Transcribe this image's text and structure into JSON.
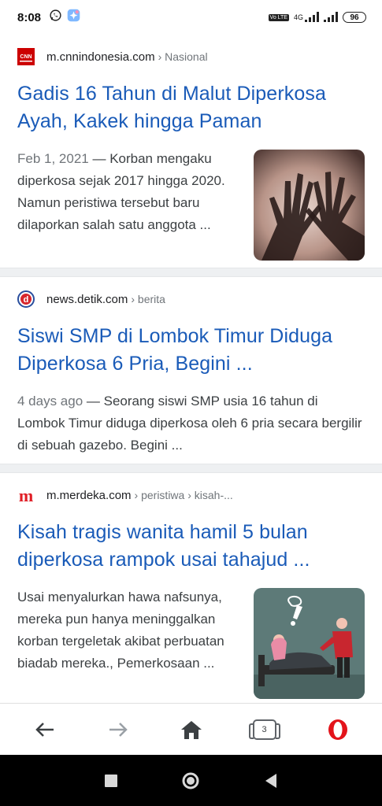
{
  "status_bar": {
    "time": "8:08",
    "network": "4G",
    "volte": "Vo LTE",
    "battery": "96"
  },
  "results": [
    {
      "source_domain": "m.cnnindonesia.com",
      "source_path": "› Nasional",
      "favicon_label": "CNN",
      "headline": "Gadis 16 Tahun di Malut Diperkosa Ayah, Kakek hingga Paman",
      "date": "Feb 1, 2021",
      "snippet": " — Korban mengaku diperkosa sejak 2017 hingga 2020. Namun peristiwa tersebut baru dilaporkan salah satu anggota ..."
    },
    {
      "source_domain": "news.detik.com",
      "source_path": "› berita",
      "favicon_label": "d",
      "headline": "Siswi SMP di Lombok Timur Diduga Diperkosa 6 Pria, Begini ...",
      "date": "4 days ago",
      "snippet": " — Seorang siswi SMP usia 16 tahun di Lombok Timur diduga diperkosa oleh 6 pria secara bergilir di sebuah gazebo. Begini  ..."
    },
    {
      "source_domain": "m.merdeka.com",
      "source_path": "› peristiwa › kisah-...",
      "favicon_label": "m",
      "headline": "Kisah tragis wanita hamil 5 bulan diperkosa rampok usai tahajud ...",
      "date": "",
      "snippet": "Usai menyalurkan hawa nafsunya, mereka pun hanya meninggalkan korban tergeletak akibat perbuatan biadab mereka., Pemerkosaan ..."
    }
  ],
  "bottom_nav": {
    "tab_count": "3"
  },
  "colors": {
    "link_blue": "#1a5bb8",
    "opera_red": "#e3141b",
    "cnn_red": "#cc0000",
    "merdeka_red": "#e01e26"
  }
}
